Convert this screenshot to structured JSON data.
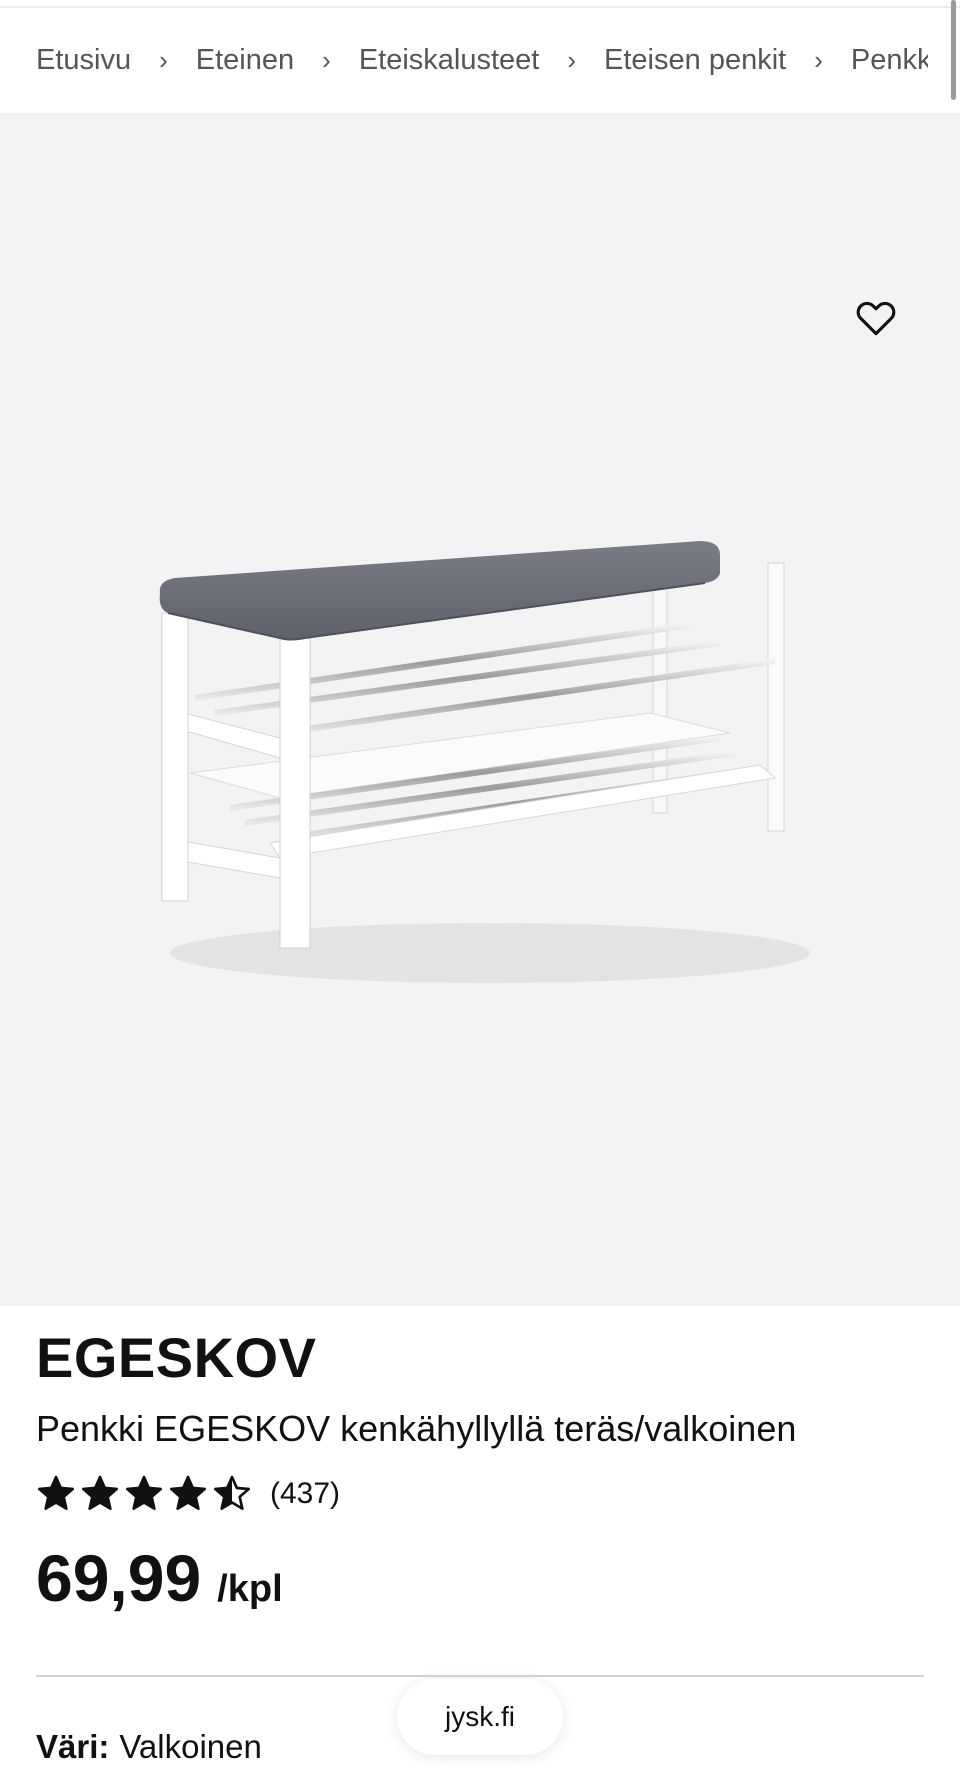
{
  "breadcrumb": {
    "items": [
      "Etusivu",
      "Eteinen",
      "Eteiskalusteet",
      "Eteisen penkit",
      "Penkki E"
    ],
    "separator": "›"
  },
  "gallery": {
    "favorite_icon": "heart-outline-icon",
    "image_alt": "Penkki EGESKOV kenkähyllyllä teräs/valkoinen",
    "dots": {
      "count": 4,
      "active_index": 0
    }
  },
  "product": {
    "brand": "EGESKOV",
    "name": "Penkki EGESKOV kenkähyllyllä teräs/valkoinen",
    "rating": {
      "value": 4.5,
      "max": 5
    },
    "review_count": "(437)",
    "price": "69,99",
    "price_unit": "/kpl",
    "color_label": "Väri:",
    "color_value": "Valkoinen"
  },
  "browser": {
    "site": "jysk.fi"
  },
  "colors": {
    "text": "#111111",
    "muted": "#555555",
    "gallery_bg": "#f3f3f3",
    "seat": "#6e7079",
    "frame": "#ffffff"
  }
}
